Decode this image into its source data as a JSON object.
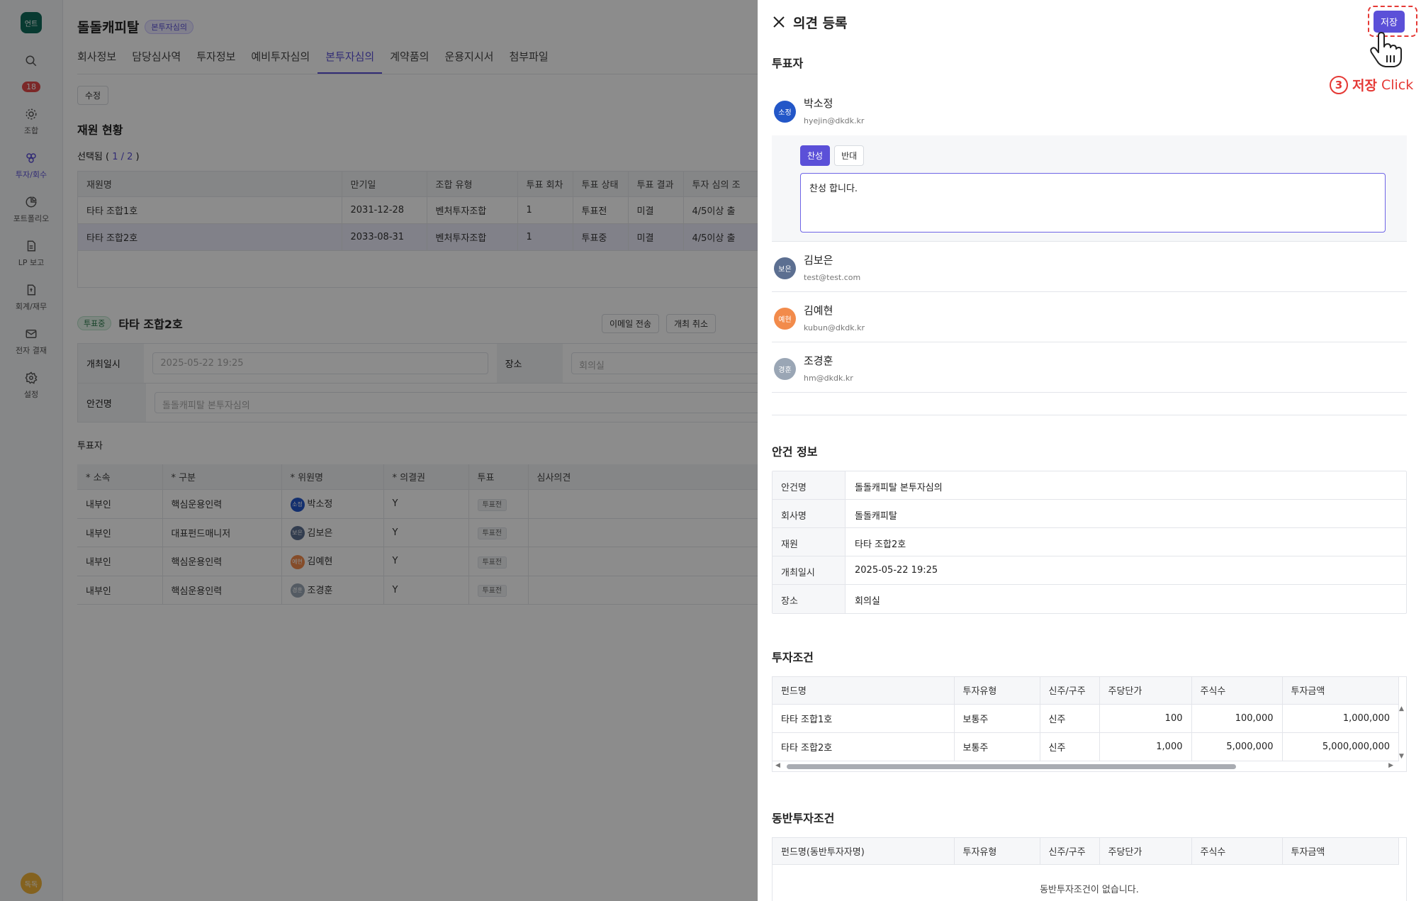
{
  "app": {
    "logo_text": "언트",
    "notification_count": "18",
    "user_avatar": "독독",
    "nav": [
      {
        "label": "",
        "icon": "search-icon"
      },
      {
        "label": "조합",
        "icon": "fund-icon"
      },
      {
        "label": "투자/회수",
        "icon": "invest-icon",
        "active": true
      },
      {
        "label": "포트폴리오",
        "icon": "portfolio-icon"
      },
      {
        "label": "LP 보고",
        "icon": "document-icon"
      },
      {
        "label": "회계/재무",
        "icon": "accounting-icon"
      },
      {
        "label": "전자 결재",
        "icon": "mail-icon"
      },
      {
        "label": "설정",
        "icon": "gear-icon"
      }
    ]
  },
  "page": {
    "title": "돌돌캐피탈",
    "title_tag": "본투자심의",
    "tabs": [
      "회사정보",
      "담당심사역",
      "투자정보",
      "예비투자심의",
      "본투자심의",
      "계약품의",
      "운용지시서",
      "첨부파일"
    ],
    "active_tab": 4,
    "edit_button": "수정",
    "fund_section_title": "재원 현황",
    "selected_prefix": "선택됨 ( ",
    "selected_value": "1 / 2",
    "selected_suffix": " )",
    "fund_table": {
      "headers": [
        "재원명",
        "만기일",
        "조합 유형",
        "투표 회차",
        "투표 상태",
        "투표 결과",
        "투자 심의 조"
      ],
      "rows": [
        [
          "타타 조합1호",
          "2031-12-28",
          "벤처투자조합",
          "1",
          "투표전",
          "미결",
          "4/5이상 출"
        ],
        [
          "타타 조합2호",
          "2033-08-31",
          "벤처투자조합",
          "1",
          "투표중",
          "미결",
          "4/5이상 출"
        ]
      ]
    },
    "meeting": {
      "status_tag": "투표중",
      "name": "타타 조합2호",
      "email_button": "이메일 전송",
      "cancel_button": "개최 취소",
      "date_label": "개최일시",
      "date_value": "2025-05-22 19:25",
      "place_label": "장소",
      "place_value": "회의실",
      "agenda_label": "안건명",
      "agenda_value": "돌돌캐피탈 본투자심의"
    },
    "voters_label": "투표자",
    "voter_table": {
      "headers": [
        "* 소속",
        "* 구분",
        "* 위원명",
        "* 의결권",
        "투표",
        "심사의견"
      ],
      "rows": [
        [
          "내부인",
          "핵심운용인력",
          "박소정",
          "Y",
          "투표전"
        ],
        [
          "내부인",
          "대표펀드매니저",
          "김보은",
          "Y",
          "투표전"
        ],
        [
          "내부인",
          "핵심운용인력",
          "김예현",
          "Y",
          "투표전"
        ],
        [
          "내부인",
          "핵심운용인력",
          "조경훈",
          "Y",
          "투표전"
        ]
      ],
      "avatars": [
        "소정",
        "보은",
        "예현",
        "경훈"
      ]
    }
  },
  "drawer": {
    "title": "의견 등록",
    "save_button": "저장",
    "annotation_number": "3",
    "annotation_text": "저장",
    "annotation_click": "Click",
    "voters_title": "투표자",
    "voters": [
      {
        "avatar": "소정",
        "name": "박소정",
        "email": "hyejin@dkdk.kr",
        "color": "#2357c8"
      },
      {
        "avatar": "보은",
        "name": "김보은",
        "email": "test@test.com",
        "color": "#5c6f91"
      },
      {
        "avatar": "예현",
        "name": "김예현",
        "email": "kubun@dkdk.kr",
        "color": "#f28b4b"
      },
      {
        "avatar": "경훈",
        "name": "조경훈",
        "email": "hm@dkdk.kr",
        "color": "#9aa6b5"
      }
    ],
    "vote_options": [
      "찬성",
      "반대"
    ],
    "selected_vote": "찬성",
    "opinion_text": "찬성 합니다.",
    "agenda_info_title": "안건 정보",
    "agenda_info": [
      {
        "key": "안건명",
        "value": "돌돌캐피탈 본투자심의"
      },
      {
        "key": "회사명",
        "value": "돌돌캐피탈"
      },
      {
        "key": "재원",
        "value": "타타 조합2호"
      },
      {
        "key": "개최일시",
        "value": "2025-05-22 19:25"
      },
      {
        "key": "장소",
        "value": "회의실"
      }
    ],
    "terms_title": "투자조건",
    "terms_headers": [
      "펀드명",
      "투자유형",
      "신주/구주",
      "주당단가",
      "주식수",
      "투자금액"
    ],
    "terms_rows": [
      [
        "타타 조합1호",
        "보통주",
        "신주",
        "100",
        "100,000",
        "1,000,000"
      ],
      [
        "타타 조합2호",
        "보통주",
        "신주",
        "1,000",
        "5,000,000",
        "5,000,000,000"
      ]
    ],
    "co_terms_title": "동반투자조건",
    "co_terms_headers": [
      "펀드명(동반투자자명)",
      "투자유형",
      "신주/구주",
      "주당단가",
      "주식수",
      "투자금액"
    ],
    "co_terms_empty": "동반투자조건이 없습니다."
  }
}
